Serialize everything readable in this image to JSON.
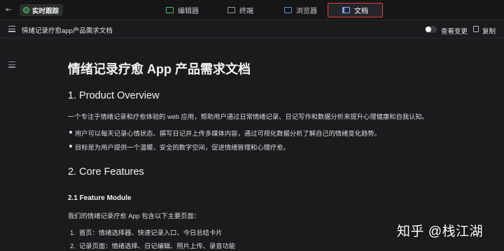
{
  "topbar": {
    "live_label": "实时跟踪",
    "tabs": [
      {
        "label": "编辑器",
        "icon": "editor-icon"
      },
      {
        "label": "终端",
        "icon": "terminal-icon"
      },
      {
        "label": "浏览器",
        "icon": "browser-icon"
      },
      {
        "label": "文档",
        "icon": "docs-icon",
        "active": true
      }
    ],
    "active_outline_color": "#d9433a"
  },
  "docbar": {
    "title": "情绪记录疗愈app产品需求文档",
    "toggle_label": "查看变更",
    "copy_label": "复制"
  },
  "document": {
    "title": "情绪记录疗愈 App 产品需求文档",
    "section1": {
      "heading": "1. Product Overview",
      "paragraph": "一个专注于情绪记录和疗愈体验的 web 应用，帮助用户通过日常情绪记录、日记写作和数据分析来提升心理健康和自我认知。",
      "bullets": [
        "用户可以每天记录心情状态、撰写日记并上传多媒体内容，通过可视化数据分析了解自己的情绪变化趋势。",
        "目标是为用户提供一个温暖、安全的数字空间，促进情绪管理和心理疗愈。"
      ]
    },
    "section2": {
      "heading": "2. Core Features",
      "subheading": "2.1 Feature Module",
      "paragraph": "我们的情绪记录疗愈 App 包含以下主要页面：",
      "list": [
        {
          "num": "1.",
          "text": "首页：情绪选择器、快速记录入口、今日总结卡片"
        },
        {
          "num": "2.",
          "text": "记录页面：情绪选择、日记编辑、照片上传、录音功能"
        }
      ]
    }
  },
  "watermark": "知乎 @栈江湖"
}
